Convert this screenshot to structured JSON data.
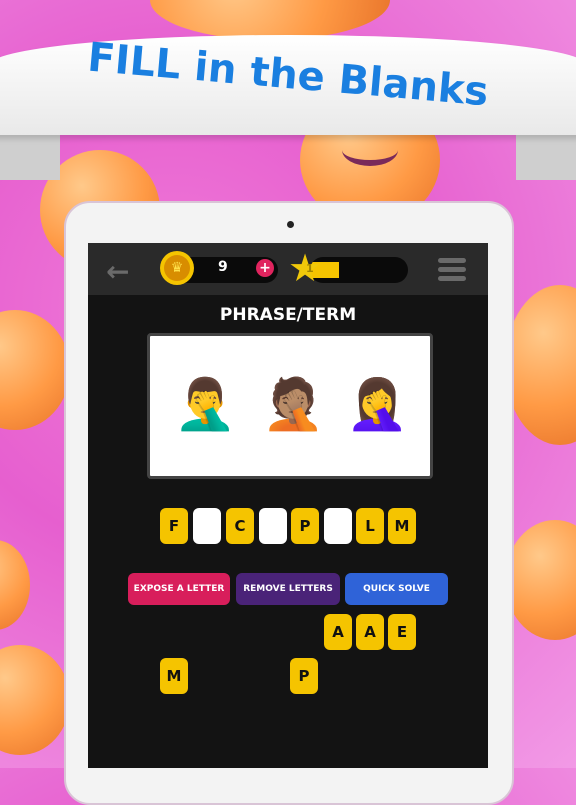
{
  "banner": {
    "title": "FILL in the Blanks"
  },
  "topbar": {
    "back_icon": "left-arrow-icon",
    "coins": "9",
    "add_coins_icon": "plus-icon",
    "level": "1",
    "level_progress_percent": 30,
    "menu_icon": "hamburger-menu-icon"
  },
  "puzzle": {
    "category": "PHRASE/TERM",
    "clue_emojis": [
      "🤦‍♂️",
      "🤦🏽",
      "🤦‍♀️"
    ],
    "answer_slots": [
      {
        "letter": "F",
        "filled": true
      },
      {
        "letter": "",
        "filled": false
      },
      {
        "letter": "C",
        "filled": true
      },
      {
        "letter": "",
        "filled": false
      },
      {
        "letter": "P",
        "filled": true
      },
      {
        "letter": "",
        "filled": false
      },
      {
        "letter": "L",
        "filled": true
      },
      {
        "letter": "M",
        "filled": true
      }
    ]
  },
  "hints": {
    "expose": {
      "label": "EXPOSE A LETTER",
      "color": "#d81e5b"
    },
    "remove": {
      "label": "REMOVE LETTERS",
      "color": "#4a2378"
    },
    "solve": {
      "label": "QUICK SOLVE",
      "color": "#2f63d8"
    }
  },
  "letter_bank": [
    "A",
    "A",
    "E",
    "M",
    "P"
  ]
}
